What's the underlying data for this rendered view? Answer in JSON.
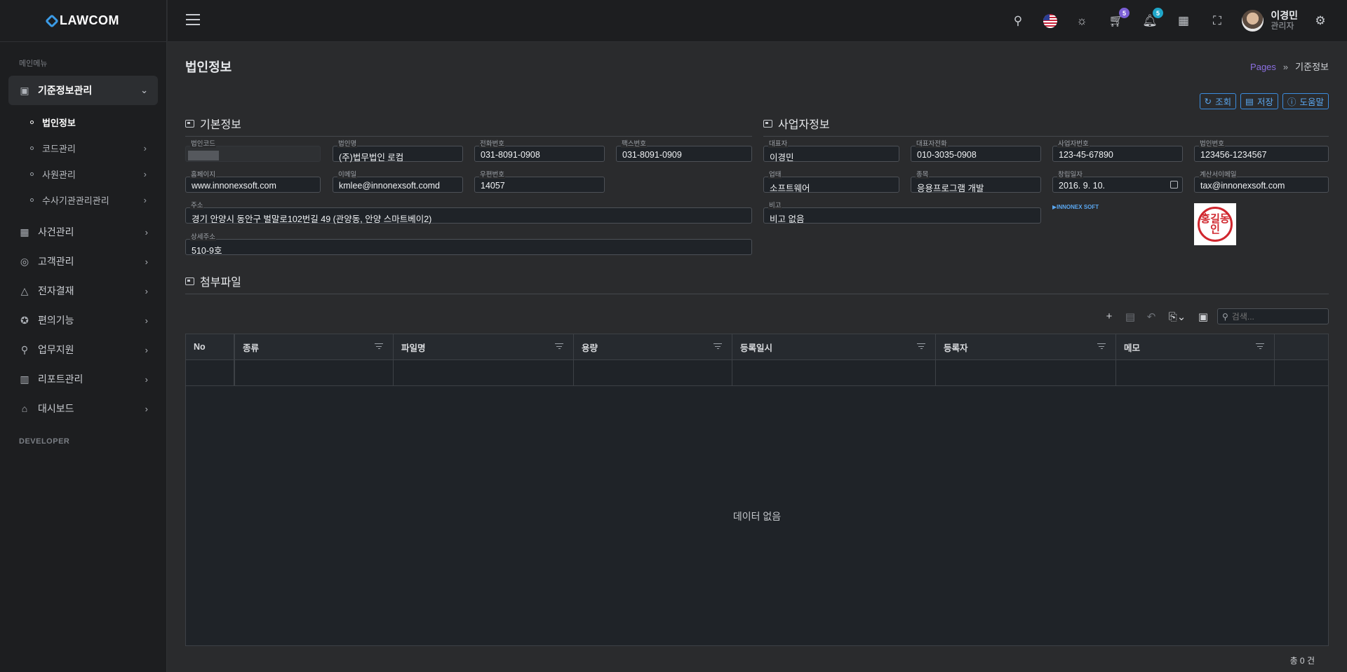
{
  "sidebar": {
    "logo": "LAWCOM",
    "caption": "메인메뉴",
    "items": [
      {
        "label": "기준정보관리",
        "icon": "clipboard-check-icon",
        "active": true
      },
      {
        "label": "사건관리",
        "icon": "grid-icon"
      },
      {
        "label": "고객관리",
        "icon": "fingerprint-icon"
      },
      {
        "label": "전자결재",
        "icon": "alert-triangle-icon"
      },
      {
        "label": "편의기능",
        "icon": "medal-icon"
      },
      {
        "label": "업무지원",
        "icon": "map-pin-icon"
      },
      {
        "label": "리포트관리",
        "icon": "report-chart-icon"
      },
      {
        "label": "대시보드",
        "icon": "home-icon"
      }
    ],
    "submenu": [
      {
        "label": "법인정보",
        "active": true
      },
      {
        "label": "코드관리"
      },
      {
        "label": "사원관리"
      },
      {
        "label": "수사기관관리관리"
      }
    ],
    "dev_caption": "DEVELOPER"
  },
  "topbar": {
    "cart_badge": "5",
    "bell_badge": "5",
    "badge_colors": {
      "cart": "#7b5fd6",
      "bell": "#1fa6c9"
    },
    "user_name": "이경민",
    "user_role": "관리자"
  },
  "page": {
    "title": "법인정보",
    "breadcrumb_root": "Pages",
    "breadcrumb_sep": "»",
    "breadcrumb_current": "기준정보",
    "buttons": {
      "query": "조회",
      "save": "저장",
      "help": "도움말"
    }
  },
  "basic": {
    "title": "기본정보",
    "corp_code_label": "법인코드",
    "corp_name_label": "법인명",
    "corp_name": "(주)법무법인 로컴",
    "phone_label": "전화번호",
    "phone": "031-8091-0908",
    "fax_label": "팩스번호",
    "fax": "031-8091-0909",
    "homepage_label": "홈페이지",
    "homepage": "www.innonexsoft.com",
    "email_label": "이메일",
    "email": "kmlee@innonexsoft.comd",
    "zip_label": "우편번호",
    "zip": "14057",
    "address_label": "주소",
    "address": "경기 안양시 동안구 벌말로102번길 49 (관양동, 안양 스마트베이2)",
    "detail_label": "상세주소",
    "detail": "510-9호"
  },
  "biz": {
    "title": "사업자정보",
    "ceo_label": "대표자",
    "ceo": "이경민",
    "ceo_phone_label": "대표자전화",
    "ceo_phone": "010-3035-0908",
    "bizno_label": "사업자번호",
    "bizno": "123-45-67890",
    "corpno_label": "법인번호",
    "corpno": "123456-1234567",
    "type_label": "업태",
    "type": "소프트웨어",
    "item_label": "종목",
    "item": "응용프로그램 개발",
    "founded_label": "창립일자",
    "founded": "2016. 9. 10.",
    "tax_email_label": "계산서이메일",
    "tax_email": "tax@innonexsoft.com",
    "note_label": "비고",
    "note": "비고 없음",
    "logo_text": "INNONEX SOFT",
    "seal_text": "홍길동인"
  },
  "attach": {
    "title": "첨부파일",
    "search_placeholder": "검색...",
    "columns": [
      "No",
      "종류",
      "파일명",
      "용량",
      "등록일시",
      "등록자",
      "메모"
    ],
    "empty": "데이터 없음",
    "total": "총 0 건"
  }
}
